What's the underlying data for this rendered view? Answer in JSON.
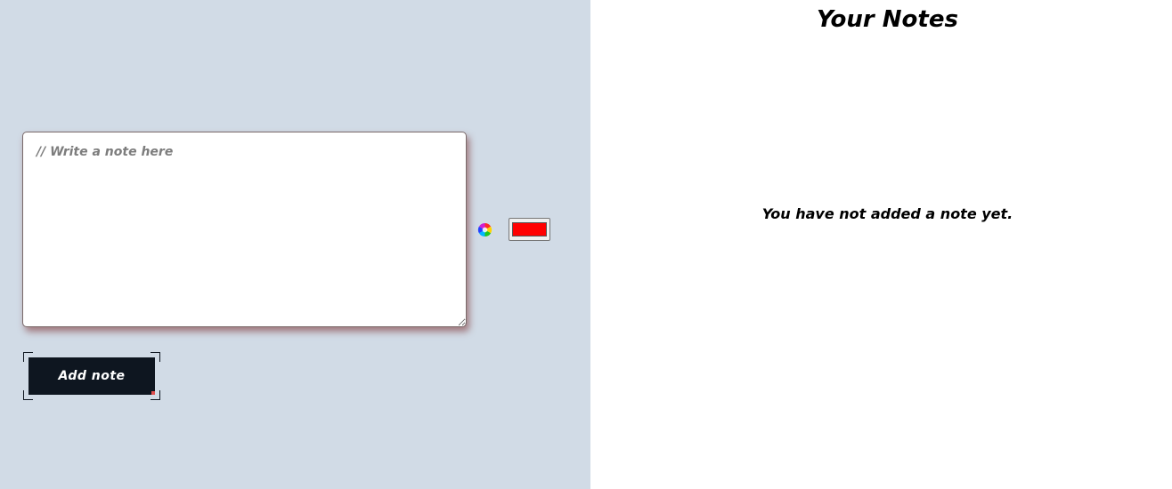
{
  "editor": {
    "note_placeholder": "// Write a note here",
    "note_value": "",
    "palette_icon": "color-palette-icon",
    "selected_color": "#ff0000",
    "add_button_label": "Add note"
  },
  "notes_panel": {
    "title": "Your Notes",
    "empty_message": "You have not added a note yet."
  },
  "colors": {
    "left_background": "#d1dbe6",
    "right_background": "#ffffff",
    "button_background": "#0e1620",
    "button_text": "#ffffff"
  }
}
